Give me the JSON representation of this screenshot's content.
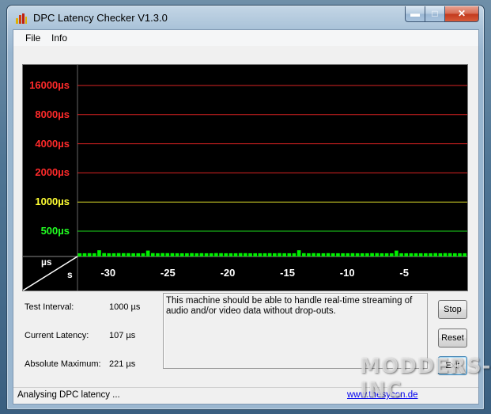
{
  "window": {
    "title": "DPC Latency Checker V1.3.0"
  },
  "titlebar_buttons": {
    "minimize": "▬",
    "maximize": "□",
    "close": "✕"
  },
  "menu": {
    "items": [
      "File",
      "Info"
    ]
  },
  "chart_data": {
    "type": "bar",
    "title": "",
    "y_scale": "log",
    "y_unit": "µs",
    "x_unit": "s",
    "y_ticks": [
      {
        "value": 16000,
        "label": "16000µs",
        "color": "#ff2a2a"
      },
      {
        "value": 8000,
        "label": "8000µs",
        "color": "#ff2a2a"
      },
      {
        "value": 4000,
        "label": "4000µs",
        "color": "#ff2a2a"
      },
      {
        "value": 2000,
        "label": "2000µs",
        "color": "#ff2a2a"
      },
      {
        "value": 1000,
        "label": "1000µs",
        "color": "#ffff33"
      },
      {
        "value": 500,
        "label": "500µs",
        "color": "#22ff22"
      }
    ],
    "x_ticks": [
      -30,
      -25,
      -20,
      -15,
      -10,
      -5
    ],
    "xlim": [
      -32.6,
      0
    ],
    "series": [
      {
        "color": "#00ee00",
        "values": [
          107,
          107,
          110,
          107,
          128,
          112,
          107,
          107,
          112,
          110,
          110,
          107,
          107,
          107,
          117,
          112,
          107,
          112,
          110,
          110,
          107,
          107,
          107,
          112,
          107,
          110,
          107,
          107,
          112,
          110,
          107,
          107,
          107,
          112,
          110,
          107,
          107,
          107,
          107,
          110,
          107,
          112,
          107,
          107,
          107,
          128,
          110,
          107,
          112,
          107,
          107,
          110,
          107,
          107,
          107,
          107,
          110,
          107,
          107,
          107,
          112,
          112,
          107,
          107,
          107,
          117,
          107,
          107,
          107,
          107,
          107,
          107,
          107,
          112,
          107,
          112,
          110,
          107,
          107,
          107
        ]
      }
    ]
  },
  "chart_axis": {
    "y_unit_label": "µs",
    "x_unit_label": "s"
  },
  "stats": {
    "test_interval_label": "Test Interval:",
    "test_interval_value": "1000 µs",
    "current_latency_label": "Current Latency:",
    "current_latency_value": "107 µs",
    "absolute_max_label": "Absolute Maximum:",
    "absolute_max_value": "221 µs"
  },
  "message": "This machine should be able to handle real-time streaming of audio and/or video data without drop-outs.",
  "buttons": {
    "stop": "Stop",
    "reset": "Reset",
    "exit": "Exit"
  },
  "status": {
    "text": "Analysing DPC latency ...",
    "link": "www.thesycon.de"
  },
  "watermark": "MODDERS-INC",
  "colors": {
    "chart_bg": "#000000",
    "bar": "#00ee00",
    "red_line": "#cc0000",
    "yellow_line": "#dddd00",
    "green_line": "#00cc00"
  }
}
